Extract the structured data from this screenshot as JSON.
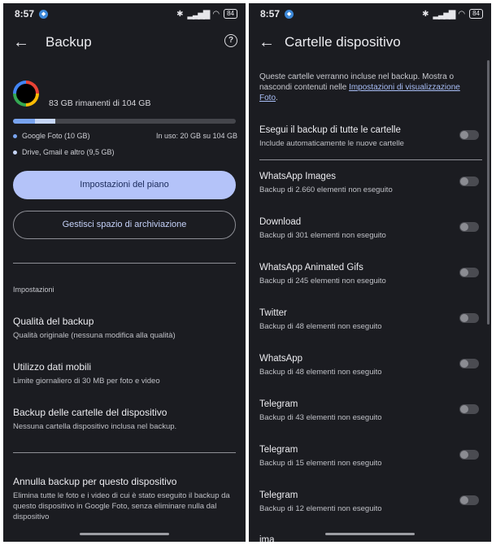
{
  "status": {
    "time": "8:57",
    "battery": "84"
  },
  "left": {
    "title": "Backup",
    "storage": {
      "remaining": "83 GB rimanenti di 104 GB",
      "used_fraction": 0.19,
      "photos_fraction": 0.1,
      "legend_photos": "Google Foto (10 GB)",
      "legend_other": "Drive, Gmail e altro (9,5 GB)",
      "in_use": "In uso: 20 GB su 104 GB",
      "color_photos": "#79a4ef",
      "color_other": "#c6d6f8"
    },
    "btn_plan": "Impostazioni del piano",
    "btn_manage": "Gestisci spazio di archiviazione",
    "section": "Impostazioni",
    "items": [
      {
        "title": "Qualità del backup",
        "sub": "Qualità originale (nessuna modifica alla qualità)"
      },
      {
        "title": "Utilizzo dati mobili",
        "sub": "Limite giornaliero di 30 MB per foto e video"
      },
      {
        "title": "Backup delle cartelle del dispositivo",
        "sub": "Nessuna cartella dispositivo inclusa nel backup."
      },
      {
        "title": "Annulla backup per questo dispositivo",
        "sub": "Elimina tutte le foto e i video di cui è stato eseguito il backup da questo dispositivo in Google Foto, senza eliminare nulla dal dispositivo"
      }
    ]
  },
  "right": {
    "title": "Cartelle dispositivo",
    "intro_text": "Queste cartelle verranno incluse nel backup. Mostra o nascondi contenuti nelle ",
    "intro_link": "Impostazioni di visualizzazione Foto",
    "intro_end": ".",
    "all": {
      "title": "Esegui il backup di tutte le cartelle",
      "sub": "Include automaticamente le nuove cartelle"
    },
    "folders": [
      {
        "title": "WhatsApp Images",
        "sub": "Backup di 2.660 elementi non eseguito"
      },
      {
        "title": "Download",
        "sub": "Backup di 301 elementi non eseguito"
      },
      {
        "title": "WhatsApp Animated Gifs",
        "sub": "Backup di 245 elementi non eseguito"
      },
      {
        "title": "Twitter",
        "sub": "Backup di 48 elementi non eseguito"
      },
      {
        "title": "WhatsApp",
        "sub": "Backup di 48 elementi non eseguito"
      },
      {
        "title": "Telegram",
        "sub": "Backup di 43 elementi non eseguito"
      },
      {
        "title": "Telegram",
        "sub": "Backup di 15 elementi non eseguito"
      },
      {
        "title": "Telegram",
        "sub": "Backup di 12 elementi non eseguito"
      }
    ],
    "cut_off": "ima"
  }
}
